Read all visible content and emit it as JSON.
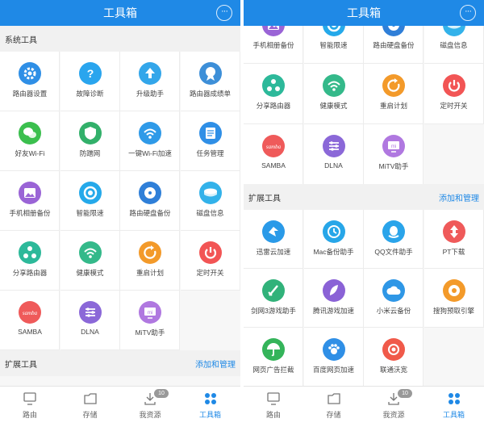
{
  "title": "工具箱",
  "more_label": "···",
  "colors": {
    "header": "#1f89e6",
    "accent": "#1f89e6"
  },
  "left": {
    "system_section": "系统工具",
    "system_tools": [
      {
        "label": "路由器设置",
        "icon": "gear-icon",
        "color": "#2f8fe6"
      },
      {
        "label": "故障诊断",
        "icon": "question-icon",
        "color": "#2aa5ee"
      },
      {
        "label": "升级助手",
        "icon": "upload-icon",
        "color": "#33a6ea"
      },
      {
        "label": "路由器成绩单",
        "icon": "medal-icon",
        "color": "#3d8fd8"
      },
      {
        "label": "好友Wi-Fi",
        "icon": "wechat-icon",
        "color": "#3bbf4e"
      },
      {
        "label": "防蹭网",
        "icon": "shield-icon",
        "color": "#32b06a"
      },
      {
        "label": "一键Wi-Fi加速",
        "icon": "wifi-boost-icon",
        "color": "#2f9ae8"
      },
      {
        "label": "任务管理",
        "icon": "task-icon",
        "color": "#2f8fe6"
      },
      {
        "label": "手机相册备份",
        "icon": "photo-icon",
        "color": "#9a64d6"
      },
      {
        "label": "智能限速",
        "icon": "speed-icon",
        "color": "#25a9ea"
      },
      {
        "label": "路由硬盘备份",
        "icon": "disk-icon",
        "color": "#2f7fd8"
      },
      {
        "label": "磁盘信息",
        "icon": "disk-info-icon",
        "color": "#33b2ea"
      },
      {
        "label": "分享路由器",
        "icon": "share-icon",
        "color": "#2db99a"
      },
      {
        "label": "健康模式",
        "icon": "wifi-icon",
        "color": "#34b98a"
      },
      {
        "label": "重启计划",
        "icon": "restart-icon",
        "color": "#f39a2a"
      },
      {
        "label": "定时开关",
        "icon": "power-icon",
        "color": "#f25555"
      },
      {
        "label": "SAMBA",
        "icon": "samba-icon",
        "color": "#ef5a5a"
      },
      {
        "label": "DLNA",
        "icon": "dlna-icon",
        "color": "#8b68d8"
      },
      {
        "label": "MiTV助手",
        "icon": "tv-icon",
        "color": "#b078e0"
      }
    ],
    "extension_section": "扩展工具",
    "add_manage": "添加和管理"
  },
  "right": {
    "system_tools": [
      {
        "label": "手机相册备份",
        "icon": "photo-icon",
        "color": "#9a64d6"
      },
      {
        "label": "智能限速",
        "icon": "speed-icon",
        "color": "#25a9ea"
      },
      {
        "label": "路由硬盘备份",
        "icon": "disk-icon",
        "color": "#2f7fd8"
      },
      {
        "label": "磁盘信息",
        "icon": "disk-info-icon",
        "color": "#33b2ea"
      },
      {
        "label": "分享路由器",
        "icon": "share-icon",
        "color": "#2db99a"
      },
      {
        "label": "健康模式",
        "icon": "wifi-icon",
        "color": "#34b98a"
      },
      {
        "label": "重启计划",
        "icon": "restart-icon",
        "color": "#f39a2a"
      },
      {
        "label": "定时开关",
        "icon": "power-icon",
        "color": "#f25555"
      },
      {
        "label": "SAMBA",
        "icon": "samba-icon",
        "color": "#ef5a5a"
      },
      {
        "label": "DLNA",
        "icon": "dlna-icon",
        "color": "#8b68d8"
      },
      {
        "label": "MiTV助手",
        "icon": "tv-icon",
        "color": "#b078e0"
      }
    ],
    "extension_section": "扩展工具",
    "add_manage": "添加和管理",
    "extension_tools": [
      {
        "label": "迅雷云加速",
        "icon": "thunder-icon",
        "color": "#2a9ae8"
      },
      {
        "label": "Mac备份助手",
        "icon": "clock-icon",
        "color": "#27a6e8"
      },
      {
        "label": "QQ文件助手",
        "icon": "qq-icon",
        "color": "#2aa4ea"
      },
      {
        "label": "PT下载",
        "icon": "pt-icon",
        "color": "#ef5a5a"
      },
      {
        "label": "剑网3游戏助手",
        "icon": "sword-icon",
        "color": "#31b27a"
      },
      {
        "label": "腾讯游戏加速",
        "icon": "feather-icon",
        "color": "#8a62d6"
      },
      {
        "label": "小米云备份",
        "icon": "cloud-icon",
        "color": "#2f97e6"
      },
      {
        "label": "搜狗预取引擎",
        "icon": "record-icon",
        "color": "#f39a2a"
      },
      {
        "label": "网页广告拦截",
        "icon": "umbrella-icon",
        "color": "#34b45a"
      },
      {
        "label": "百度网页加速",
        "icon": "baidu-icon",
        "color": "#2f8fe6"
      },
      {
        "label": "联通沃宽",
        "icon": "unicom-icon",
        "color": "#f05a4a"
      }
    ]
  },
  "tabs": [
    {
      "label": "路由",
      "icon": "monitor-icon"
    },
    {
      "label": "存储",
      "icon": "folder-icon"
    },
    {
      "label": "我资源",
      "icon": "download-icon",
      "badge": "10"
    },
    {
      "label": "工具箱",
      "icon": "grid-icon",
      "active": true
    }
  ]
}
